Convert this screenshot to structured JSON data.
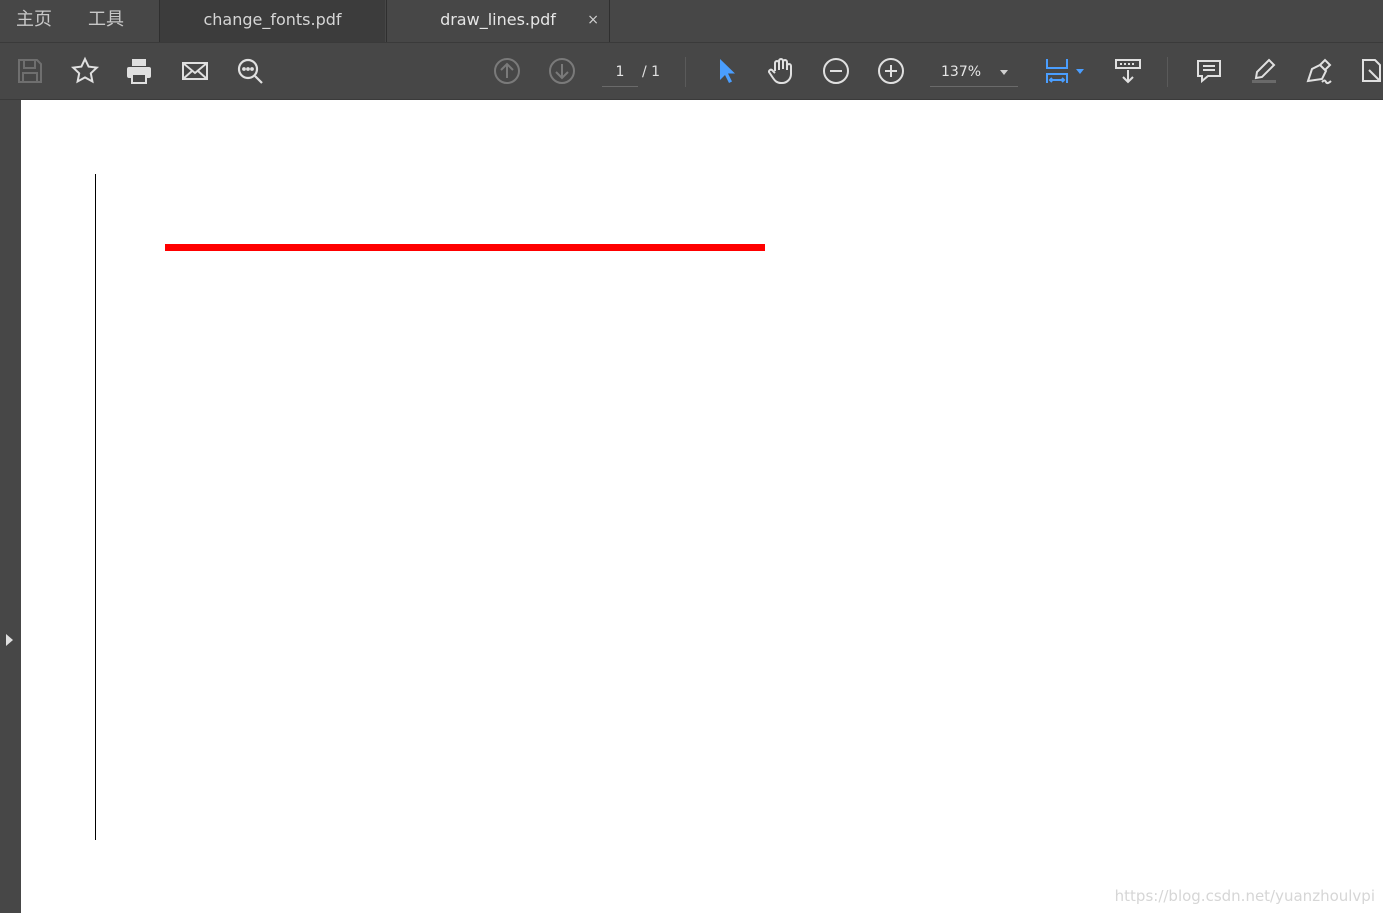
{
  "tabbar": {
    "home_label": "主页",
    "tools_label": "工具",
    "tabs": [
      {
        "label": "change_fonts.pdf",
        "active": false
      },
      {
        "label": "draw_lines.pdf",
        "active": true,
        "close": "×"
      }
    ]
  },
  "toolbar": {
    "icons": [
      "save-icon",
      "bookmark-star-icon",
      "print-icon",
      "email-icon",
      "search-icon",
      "page-up-icon",
      "page-down-icon",
      "select-cursor-icon",
      "hand-icon",
      "zoom-out-icon",
      "zoom-in-icon",
      "fit-page-icon",
      "scroll-mode-icon",
      "comment-icon",
      "highlight-pen-icon",
      "sign-icon",
      "export-icon"
    ],
    "page_current": "1",
    "page_total": "/ 1",
    "zoom": "137%"
  },
  "document": {
    "line_color": "#ff0000",
    "watermark": "https://blog.csdn.net/yuanzhoulvpi"
  },
  "colors": {
    "chrome": "#474747",
    "accent": "#4a9eff"
  }
}
